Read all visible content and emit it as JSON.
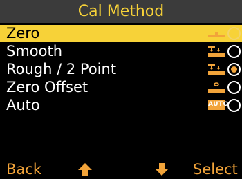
{
  "header": {
    "title": "Cal Method"
  },
  "menu": {
    "items": [
      {
        "label": "Zero",
        "icon": "zero-cal-icon",
        "selected_row": true,
        "radio_checked": false
      },
      {
        "label": "Smooth",
        "icon": "smooth-cal-icon",
        "selected_row": false,
        "radio_checked": false
      },
      {
        "label": "Rough / 2 Point",
        "icon": "rough-2-point-cal-icon",
        "selected_row": false,
        "radio_checked": true
      },
      {
        "label": "Zero Offset",
        "icon": "zero-offset-cal-icon",
        "selected_row": false,
        "radio_checked": false
      },
      {
        "label": "Auto",
        "icon": "auto-badge",
        "badge_text": "AUTO",
        "selected_row": false,
        "radio_checked": false
      }
    ]
  },
  "softkeys": {
    "back": "Back",
    "up": "up-arrow-icon",
    "down": "down-arrow-icon",
    "select": "Select"
  },
  "colors": {
    "background": "#000000",
    "title_bar": "#3b3b3b",
    "highlight": "#f7d238",
    "accent": "#f2a43a",
    "text": "#ffffff"
  }
}
